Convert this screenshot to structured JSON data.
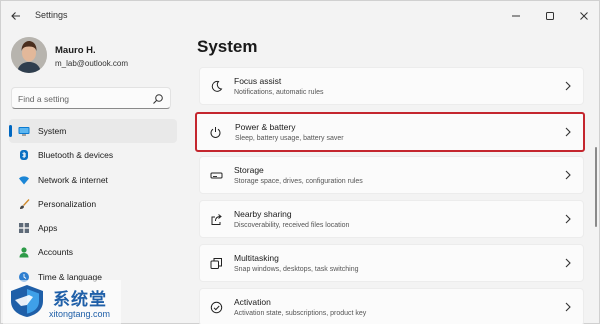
{
  "window": {
    "title": "Settings"
  },
  "profile": {
    "name": "Mauro H.",
    "email": "m_lab@outlook.com"
  },
  "search": {
    "placeholder": "Find a setting"
  },
  "sidebar": {
    "items": [
      {
        "label": "System",
        "icon": "monitor-icon",
        "active": true
      },
      {
        "label": "Bluetooth & devices",
        "icon": "bluetooth-icon",
        "active": false
      },
      {
        "label": "Network & internet",
        "icon": "wifi-icon",
        "active": false
      },
      {
        "label": "Personalization",
        "icon": "brush-icon",
        "active": false
      },
      {
        "label": "Apps",
        "icon": "apps-icon",
        "active": false
      },
      {
        "label": "Accounts",
        "icon": "person-icon",
        "active": false
      },
      {
        "label": "Time & language",
        "icon": "globe-clock-icon",
        "active": false
      }
    ]
  },
  "main": {
    "title": "System",
    "cards": [
      {
        "title": "Focus assist",
        "subtitle": "Notifications, automatic rules",
        "icon": "moon-icon"
      },
      {
        "title": "Power & battery",
        "subtitle": "Sleep, battery usage, battery saver",
        "icon": "power-icon",
        "highlighted": true
      },
      {
        "title": "Storage",
        "subtitle": "Storage space, drives, configuration rules",
        "icon": "storage-icon"
      },
      {
        "title": "Nearby sharing",
        "subtitle": "Discoverability, received files location",
        "icon": "share-icon"
      },
      {
        "title": "Multitasking",
        "subtitle": "Snap windows, desktops, task switching",
        "icon": "multitask-icon"
      },
      {
        "title": "Activation",
        "subtitle": "Activation state, subscriptions, product key",
        "icon": "activation-icon"
      }
    ]
  },
  "watermark": {
    "text": "系统堂",
    "site": "xitongtang.com"
  },
  "colors": {
    "accent": "#0067c0",
    "highlight": "#c4262e",
    "watermark": "#1f5fa8"
  }
}
